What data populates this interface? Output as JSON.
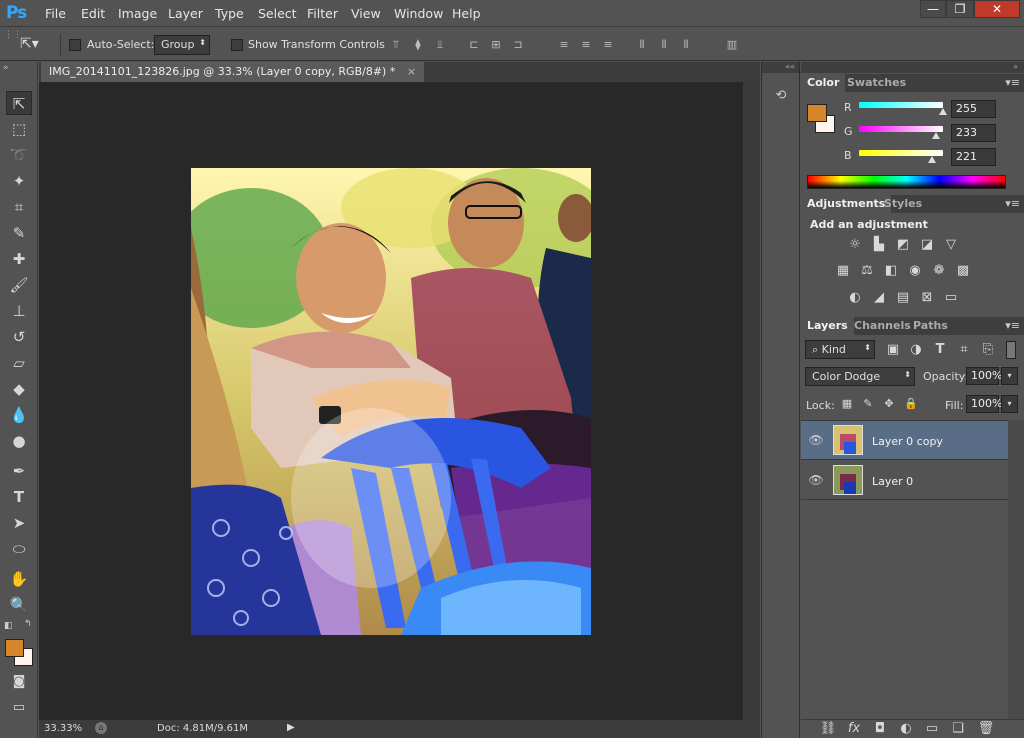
{
  "app": {
    "logo": "Ps"
  },
  "menu": [
    "File",
    "Edit",
    "Image",
    "Layer",
    "Type",
    "Select",
    "Filter",
    "View",
    "Window",
    "Help"
  ],
  "window_controls": {
    "minimize": "—",
    "restore": "❐",
    "close": "✕"
  },
  "options": {
    "auto_select_label": "Auto-Select:",
    "auto_select_value": "Group",
    "show_transform_label": "Show Transform Controls"
  },
  "document": {
    "tab_title": "IMG_20141101_123826.jpg @ 33.3% (Layer 0 copy, RGB/8#) *",
    "tab_close": "×"
  },
  "status": {
    "zoom": "33.33%",
    "doc_size": "Doc: 4.81M/9.61M"
  },
  "colors": {
    "foreground": "#d5862b",
    "background": "#fff5ee",
    "accent": "#31a8ff"
  },
  "color_panel": {
    "tabs": [
      "Color",
      "Swatches"
    ],
    "channels": [
      {
        "label": "R",
        "value": "255",
        "level": 1.0
      },
      {
        "label": "G",
        "value": "233",
        "level": 0.914
      },
      {
        "label": "B",
        "value": "221",
        "level": 0.867
      }
    ]
  },
  "adjustments_panel": {
    "tabs": [
      "Adjustments",
      "Styles"
    ],
    "heading": "Add an adjustment"
  },
  "layers_panel": {
    "tabs": [
      "Layers",
      "Channels",
      "Paths"
    ],
    "filter_kind": "Kind",
    "blend_mode": "Color Dodge",
    "opacity_label": "Opacity:",
    "opacity_value": "100%",
    "lock_label": "Lock:",
    "fill_label": "Fill:",
    "fill_value": "100%",
    "layers": [
      {
        "name": "Layer 0 copy",
        "selected": true
      },
      {
        "name": "Layer 0",
        "selected": false
      }
    ]
  }
}
